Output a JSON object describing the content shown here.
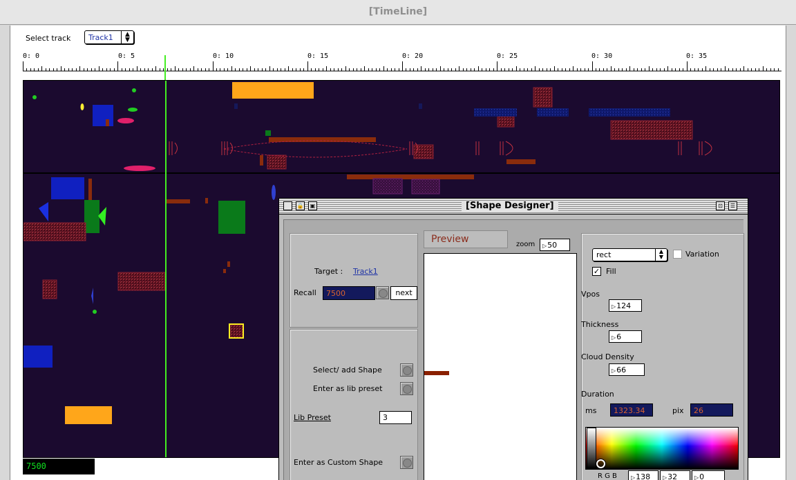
{
  "window": {
    "title": "[TimeLine]"
  },
  "toolbar": {
    "select_track_label": "Select track",
    "track_value": "Track1"
  },
  "ruler": {
    "labels": [
      "0: 0",
      "0: 5",
      "0: 10",
      "0: 15",
      "0: 20",
      "0: 25",
      "0: 30",
      "0: 35"
    ]
  },
  "counter": {
    "value": "7500"
  },
  "shape_designer": {
    "title": "[Shape Designer]",
    "target_label": "Target :",
    "target_value": "Track1",
    "recall_label": "Recall",
    "recall_value": "7500",
    "next_label": "next",
    "select_add_shape_label": "Select/ add Shape",
    "enter_lib_preset_label": "Enter as lib preset",
    "lib_preset_label": "Lib Preset",
    "lib_preset_value": "3",
    "enter_custom_shape_label": "Enter as Custom Shape",
    "preview_label": "Preview",
    "zoom_label": "zoom",
    "zoom_value": "50",
    "shape_type": "rect",
    "variation_label": "Variation",
    "variation_checked": false,
    "fill_label": "Fill",
    "fill_checked": true,
    "vpos_label": "Vpos",
    "vpos_value": "124",
    "thickness_label": "Thickness",
    "thickness_value": "6",
    "cloud_density_label": "Cloud Density",
    "cloud_density_value": "66",
    "duration_label": "Duration",
    "ms_label": "ms",
    "ms_value": "1323.34",
    "pix_label": "pix",
    "pix_value": "26",
    "rgb_label": "R G B",
    "rgb_r": "138",
    "rgb_g": "32",
    "rgb_b": "0"
  },
  "colors": {
    "background": "#1b0a2f",
    "playhead": "#44ee22",
    "orange": "#ffa61a",
    "blue": "#1020c0",
    "green": "#0a7a1a",
    "rust": "#8a2c0c",
    "magenta": "#e0206a",
    "maroon": "#6a1420"
  }
}
